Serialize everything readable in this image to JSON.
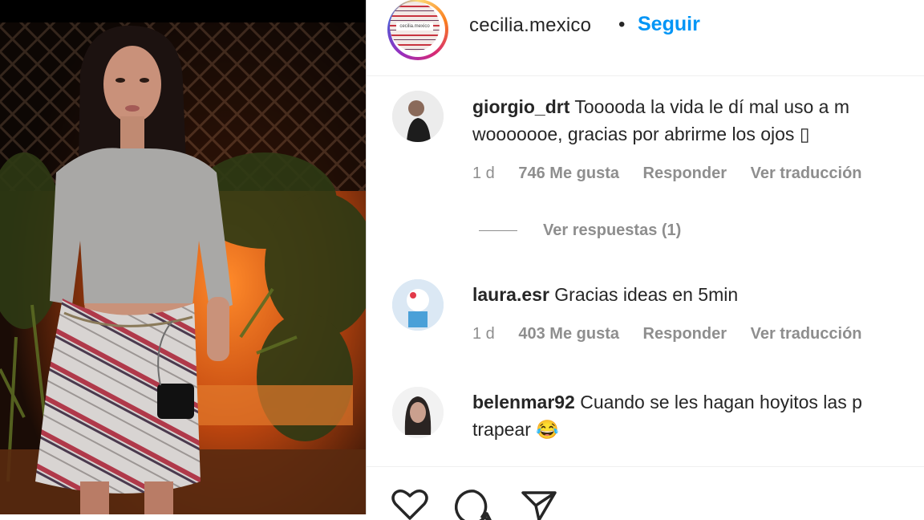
{
  "post": {
    "username": "cecilia.mexico",
    "separator": "•",
    "follow_label": "Seguir",
    "avatar_text": "cecilia.mexico"
  },
  "comments": [
    {
      "username": "giorgio_drt",
      "text_line1": "Tooooda la vida le dí mal uso a m",
      "text_line2": "wooooooe, gracias por abrirme los ojos ▯",
      "time": "1 d",
      "likes": "746 Me gusta",
      "reply": "Responder",
      "translate": "Ver traducción"
    },
    {
      "username": "laura.esr",
      "text_line1": "Gracias ideas en 5min",
      "time": "1 d",
      "likes": "403 Me gusta",
      "reply": "Responder",
      "translate": "Ver traducción"
    },
    {
      "username": "belenmar92",
      "text_line1": "Cuando se les hagan hoyitos las p",
      "text_line2": "trapear 😂"
    }
  ],
  "view_replies": "Ver respuestas (1)",
  "actions": {
    "like_icon": "heart-icon",
    "comment_icon": "comment-bubble-icon",
    "share_icon": "send-icon"
  }
}
